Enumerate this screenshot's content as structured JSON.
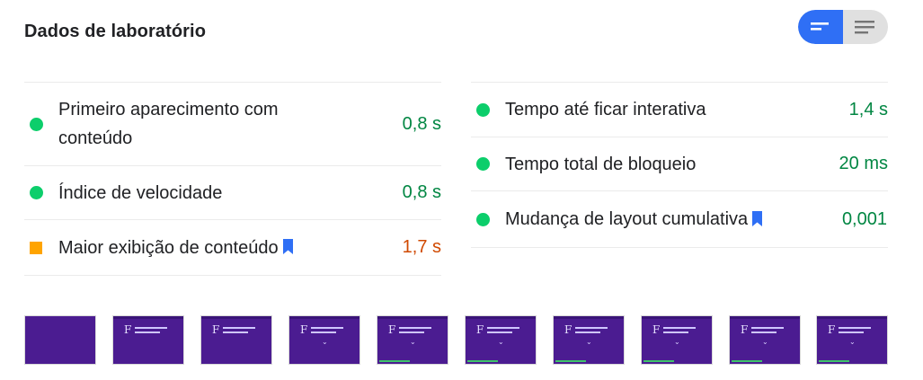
{
  "header": {
    "title": "Dados de laboratório"
  },
  "view_toggle": {
    "options": [
      {
        "icon": "summary-view-icon",
        "active": true
      },
      {
        "icon": "list-view-icon",
        "active": false
      }
    ]
  },
  "metrics_left": [
    {
      "label": "Primeiro aparecimento com conteúdo",
      "value": "0,8 s",
      "status": "good",
      "bookmark": false
    },
    {
      "label": "Índice de velocidade",
      "value": "0,8 s",
      "status": "good",
      "bookmark": false
    },
    {
      "label": "Maior exibição de conteúdo",
      "value": "1,7 s",
      "status": "average",
      "bookmark": true
    }
  ],
  "metrics_right": [
    {
      "label": "Tempo até ficar interativa",
      "value": "1,4 s",
      "status": "good",
      "bookmark": false
    },
    {
      "label": "Tempo total de bloqueio",
      "value": "20 ms",
      "status": "good",
      "bookmark": false
    },
    {
      "label": "Mudança de layout cumulativa",
      "value": "0,001",
      "status": "good",
      "bookmark": true
    }
  ],
  "colors": {
    "good": "#018642",
    "good_marker": "#0cce6b",
    "average": "#d04900",
    "average_marker": "#ffa400",
    "toggle_active": "#2f6ff5",
    "bookmark": "#2f6ff5",
    "thumbnail_bg": "#4b1c91"
  },
  "filmstrip": {
    "frame_count": 10,
    "first_frame_blank": true
  }
}
